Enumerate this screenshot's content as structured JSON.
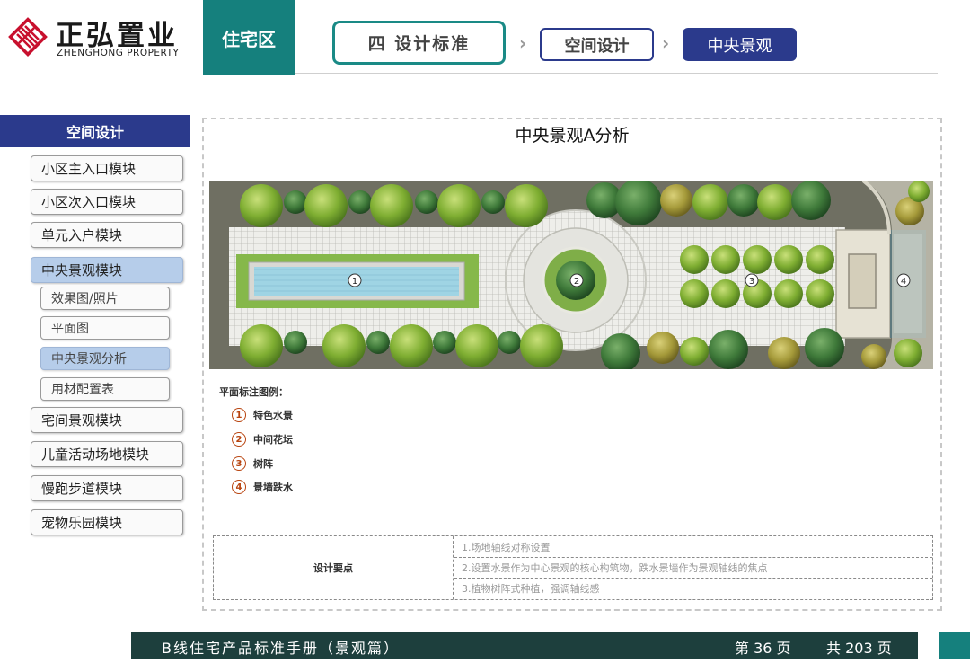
{
  "header": {
    "logo_cn": "正弘置业",
    "logo_en": "ZHENGHONG PROPERTY",
    "section": "住宅区",
    "breadcrumb": {
      "chapter": "四  设计标准",
      "sub": "空间设计",
      "current": "中央景观"
    }
  },
  "sidebar": {
    "title": "空间设计",
    "items": [
      {
        "label": "小区主入口模块"
      },
      {
        "label": "小区次入口模块"
      },
      {
        "label": "单元入户模块"
      },
      {
        "label": "中央景观模块"
      },
      {
        "label": "宅间景观模块"
      },
      {
        "label": "儿童活动场地模块"
      },
      {
        "label": "慢跑步道模块"
      },
      {
        "label": "宠物乐园模块"
      }
    ],
    "subitems": [
      {
        "label": "效果图/照片"
      },
      {
        "label": "平面图"
      },
      {
        "label": "中央景观分析"
      },
      {
        "label": "用材配置表"
      }
    ]
  },
  "content": {
    "title": "中央景观A分析",
    "plan_markers": [
      "①",
      "②",
      "③",
      "④"
    ],
    "legend_title": "平面标注图例：",
    "legend": [
      {
        "num": "1",
        "label": "特色水景"
      },
      {
        "num": "2",
        "label": "中间花坛"
      },
      {
        "num": "3",
        "label": "树阵"
      },
      {
        "num": "4",
        "label": "景墙跌水"
      }
    ],
    "design_points": {
      "heading": "设计要点",
      "rows": [
        "1.场地轴线对称设置",
        "2.设置水景作为中心景观的核心构筑物，跌水景墙作为景观轴线的焦点",
        "3.植物树阵式种植，强调轴线感"
      ]
    }
  },
  "footer": {
    "manual": "B线住宅产品标准手册（景观篇）",
    "page": "第 36 页",
    "total": "共 203 页"
  },
  "colors": {
    "brand_red": "#c8102e",
    "teal": "#15807d",
    "navy": "#2b3a8c",
    "highlight": "#b6cdea",
    "footer": "#1d3f3d"
  }
}
